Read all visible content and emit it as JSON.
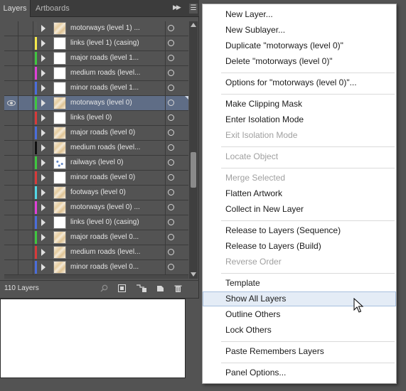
{
  "tabs": {
    "layers": "Layers",
    "artboards": "Artboards"
  },
  "panel_status": {
    "count": "110 Layers"
  },
  "layers": [
    {
      "name": "motorways (level 1) ...",
      "color": "#555555",
      "thumb": "tan",
      "selected": false,
      "visible": false
    },
    {
      "name": "links (level 1) (casing)",
      "color": "#f5e94a",
      "thumb": "white",
      "selected": false,
      "visible": false
    },
    {
      "name": "major roads (level 1...",
      "color": "#3fc73f",
      "thumb": "white",
      "selected": false,
      "visible": false
    },
    {
      "name": "medium roads (level...",
      "color": "#e040d8",
      "thumb": "white",
      "selected": false,
      "visible": false
    },
    {
      "name": "minor roads (level 1...",
      "color": "#4a6ddb",
      "thumb": "white",
      "selected": false,
      "visible": false
    },
    {
      "name": "motorways (level 0)",
      "color": "#3fc73f",
      "thumb": "tan",
      "selected": true,
      "visible": true
    },
    {
      "name": "links (level 0)",
      "color": "#d83a3a",
      "thumb": "white",
      "selected": false,
      "visible": false
    },
    {
      "name": "major roads (level 0)",
      "color": "#4a6ddb",
      "thumb": "tan",
      "selected": false,
      "visible": false
    },
    {
      "name": "medium roads (level...",
      "color": "#111111",
      "thumb": "tan",
      "selected": false,
      "visible": false
    },
    {
      "name": "railways (level 0)",
      "color": "#3fc73f",
      "thumb": "speck",
      "selected": false,
      "visible": false
    },
    {
      "name": "minor roads (level 0)",
      "color": "#d83a3a",
      "thumb": "white",
      "selected": false,
      "visible": false
    },
    {
      "name": "footways (level 0)",
      "color": "#52d8e6",
      "thumb": "tan",
      "selected": false,
      "visible": false
    },
    {
      "name": "motorways (level 0) ...",
      "color": "#e040d8",
      "thumb": "tan",
      "selected": false,
      "visible": false
    },
    {
      "name": "links (level 0) (casing)",
      "color": "#4a6ddb",
      "thumb": "white",
      "selected": false,
      "visible": false
    },
    {
      "name": "major roads (level 0...",
      "color": "#3fc73f",
      "thumb": "tan",
      "selected": false,
      "visible": false
    },
    {
      "name": "medium roads (level...",
      "color": "#d83a3a",
      "thumb": "tan",
      "selected": false,
      "visible": false
    },
    {
      "name": "minor roads (level 0...",
      "color": "#4a6ddb",
      "thumb": "tan",
      "selected": false,
      "visible": false
    }
  ],
  "menu": [
    {
      "label": "New Layer...",
      "disabled": false,
      "id": "new-layer"
    },
    {
      "label": "New Sublayer...",
      "disabled": false,
      "id": "new-sublayer"
    },
    {
      "label": "Duplicate \"motorways (level 0)\"",
      "disabled": false,
      "id": "duplicate-layer"
    },
    {
      "label": "Delete \"motorways (level 0)\"",
      "disabled": false,
      "id": "delete-layer"
    },
    {
      "sep": true
    },
    {
      "label": "Options for \"motorways (level 0)\"...",
      "disabled": false,
      "id": "layer-options"
    },
    {
      "sep": true
    },
    {
      "label": "Make Clipping Mask",
      "disabled": false,
      "id": "make-clipping-mask"
    },
    {
      "label": "Enter Isolation Mode",
      "disabled": false,
      "id": "enter-isolation-mode"
    },
    {
      "label": "Exit Isolation Mode",
      "disabled": true,
      "id": "exit-isolation-mode"
    },
    {
      "sep": true
    },
    {
      "label": "Locate Object",
      "disabled": true,
      "id": "locate-object"
    },
    {
      "sep": true
    },
    {
      "label": "Merge Selected",
      "disabled": true,
      "id": "merge-selected"
    },
    {
      "label": "Flatten Artwork",
      "disabled": false,
      "id": "flatten-artwork"
    },
    {
      "label": "Collect in New Layer",
      "disabled": false,
      "id": "collect-in-new-layer"
    },
    {
      "sep": true
    },
    {
      "label": "Release to Layers (Sequence)",
      "disabled": false,
      "id": "release-sequence"
    },
    {
      "label": "Release to Layers (Build)",
      "disabled": false,
      "id": "release-build"
    },
    {
      "label": "Reverse Order",
      "disabled": true,
      "id": "reverse-order"
    },
    {
      "sep": true
    },
    {
      "label": "Template",
      "disabled": false,
      "id": "template"
    },
    {
      "label": "Show All Layers",
      "disabled": false,
      "highlighted": true,
      "id": "show-all-layers"
    },
    {
      "label": "Outline Others",
      "disabled": false,
      "id": "outline-others"
    },
    {
      "label": "Lock Others",
      "disabled": false,
      "id": "lock-others"
    },
    {
      "sep": true
    },
    {
      "label": "Paste Remembers Layers",
      "disabled": false,
      "id": "paste-remembers-layers"
    },
    {
      "sep": true
    },
    {
      "label": "Panel Options...",
      "disabled": false,
      "id": "panel-options"
    }
  ]
}
